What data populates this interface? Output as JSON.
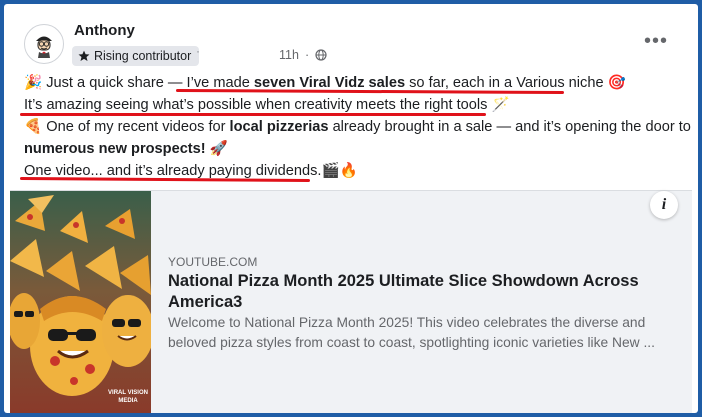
{
  "post": {
    "author": "Anthony",
    "badge": "Rising contributor",
    "separator": "·",
    "time": "11h",
    "dot": "·",
    "more": "•••",
    "lines": [
      {
        "emoji": "🎉",
        "a": " Just a quick share ",
        "b": "— I’ve made ",
        "bold": "seven Viral Vidz sales",
        "c": " so far, each in a Various niche ",
        "emoji2": "🎯"
      },
      {
        "text": "It’s amazing seeing what’s possible when creativity meets the right tools ",
        "emoji": "🪄"
      },
      {
        "emoji": "🍕",
        "a": " One of my recent videos for ",
        "bold": "local pizzerias",
        "b": " already brought in a sale — and it’s opening the door to"
      },
      {
        "bold": "numerous new prospects!",
        "emoji": " 🚀"
      },
      {
        "text": "One video... and it’s already paying dividends.",
        "emoji": "🎬🔥"
      }
    ]
  },
  "link_preview": {
    "domain": "YOUTUBE.COM",
    "title": "National Pizza Month 2025 Ultimate Slice Showdown Across America3",
    "description": "Welcome to National Pizza Month 2025! This video celebrates the diverse and beloved pizza styles from coast to coast, spotlighting iconic varieties like New ...",
    "thumb_watermark_1": "VIRAL VISION",
    "thumb_watermark_2": "MEDIA",
    "info_label": "i"
  },
  "colors": {
    "frame_bg": "#1f5da6",
    "underline": "#e0121a",
    "badge_bg": "#e4e6eb",
    "preview_bg": "#f0f2f5"
  },
  "icons": [
    "avatar",
    "star-icon",
    "globe-icon",
    "more-icon",
    "info-icon"
  ]
}
